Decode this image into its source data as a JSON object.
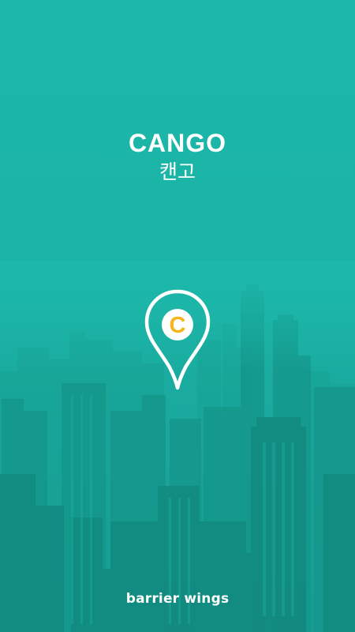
{
  "splash": {
    "app_name": "CANGO",
    "app_name_korean": "캔고",
    "logo_letter": "C",
    "brand": "barrier wings"
  },
  "colors": {
    "background": "#1cb9ab",
    "accent": "#f5b51c",
    "text": "#ffffff"
  },
  "icons": {
    "logo": "map-pin-icon"
  }
}
